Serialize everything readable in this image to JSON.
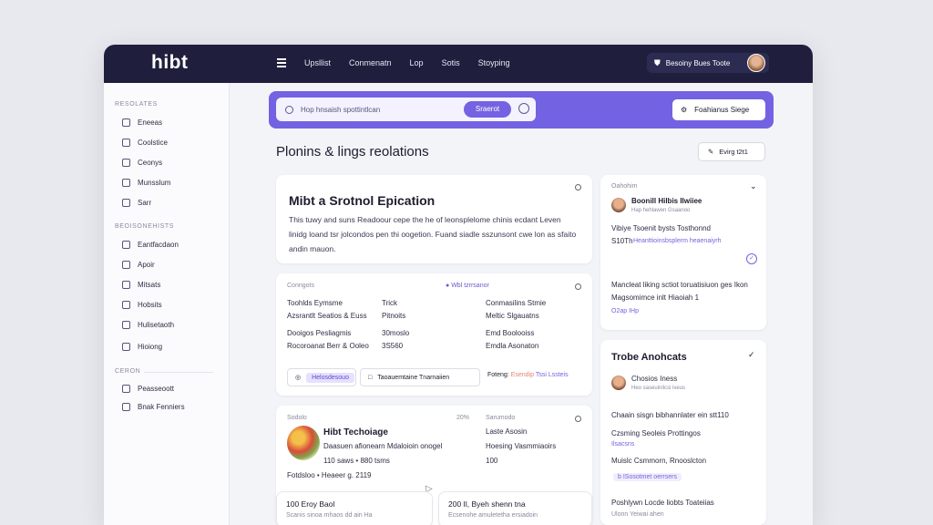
{
  "app": {
    "logo": "hibt"
  },
  "topbar": {
    "nav": [
      "Upsllist",
      "Conmenatn",
      "Lop",
      "Sotis",
      "Stoyping"
    ],
    "user_label": "Besoiny Bues Toote"
  },
  "sidebar": {
    "sections": [
      {
        "title": "RESOLATES",
        "items": [
          "Eneeas",
          "Coolstice",
          "Ceonys",
          "Munsslum",
          "Sarr"
        ]
      },
      {
        "title": "BEOISONEHISTS",
        "items": [
          "Eantfacdaon",
          "Apoir",
          "Mitsats",
          "Hobsits",
          "Hulisetaoth",
          "Hioiong"
        ]
      },
      {
        "title": "CERON",
        "items": [
          "Peasseoott",
          "Bnak Fenniers"
        ]
      }
    ]
  },
  "search": {
    "placeholder": "Hop hnsaish spottintlcan",
    "button": "Sraerot",
    "feature_button": "Foahianus Siege"
  },
  "main": {
    "title": "Plonins & lings reolations",
    "edit_button": "Evirg t2t1",
    "hero": {
      "title": "Mibt a Srotnol Epication",
      "text": "This tuwy and suns Readoour cepe the he of leonsplelome chinis ecdant Leven linidg loand tsr jolcondos pen thi oogetion. Fuand siadle sszunsont cwe lon as sfaito andin mauon."
    },
    "ingredients": {
      "header": "Conngots",
      "status": "Wbl tzrrsanor",
      "left": [
        {
          "name": "Toohlds Eymsme",
          "val": "Trick"
        },
        {
          "name": "Azsrantlt Seatios & Euss",
          "val": "Pitnoits"
        },
        {
          "name": "Dooigos Pesliagmis",
          "val": "30moslo"
        },
        {
          "name": "Rocoroanat Berr & Ooleo",
          "val": "3S560"
        }
      ],
      "right": [
        "Conmasilins Stmie",
        "Meltic Slgauatns",
        "Emd Boolooiss",
        "Emdla Asonaton"
      ],
      "tag1": "Helosdesouo",
      "tag2": "Taoauemtaine Tnarnaiien",
      "meta_label": "Foteng:",
      "meta_value": "Esendip",
      "meta_value2": "Tssi Lssteis"
    },
    "recipe": {
      "header": "Sodolo",
      "pct": "20%",
      "right_header": "Sarumodo",
      "title": "Hibt Techoiage",
      "line1": "Daasuen afionearn Mdaloioin onogel",
      "line2": "110 saws • 880 tsms",
      "line3": "Fotdsloo • Heaeer g. 2119",
      "right1": "Laste Asosin",
      "right2": "Hoesing Vasmmiaoirs",
      "right3": "100",
      "sub1_title": "100 Eroy Baol",
      "sub1_text": "Scanis sinoa mhaos dd ain Ha",
      "sub2_title": "200 Il, Byeh shenn tna",
      "sub2_text": "Ecsenohe amuletetha ersiadoin"
    }
  },
  "right_panel": {
    "card1": {
      "header": "Oahohim",
      "name": "Boonill Hilbis Ilwiiee",
      "name_sub": "Hap hehlawen Gsaanoo",
      "line1": "Vibiye Tsoenit bysts Tosthonnd",
      "line2": "S10Th",
      "link": "Heanttioinsbsplerm heaenaiyrh",
      "para": "Mancleat liking sctiot toruatisiuon ges Ikon Magsomimce inlt Hiaoiah 1",
      "para_link": "O2ap IHp"
    },
    "card2": {
      "title": "Trobe Anohcats",
      "name": "Chosios Iness",
      "name_sub": "Heo saseuinilcsi iveus",
      "items": [
        {
          "text": "Chaain sisgn bibhannlater ein stt110",
          "sub": ""
        },
        {
          "text": "Czsming Seoleis Prottingos",
          "sub": "Ilsacsns"
        },
        {
          "text": "Muislc Csmmorn, Rnooslcton",
          "sub": "b ISosotmet oerrsers"
        },
        {
          "text": "Poshlywn Locde liobts Toateiias",
          "sub": "Ulonn Yeiwai ahen"
        }
      ]
    }
  }
}
